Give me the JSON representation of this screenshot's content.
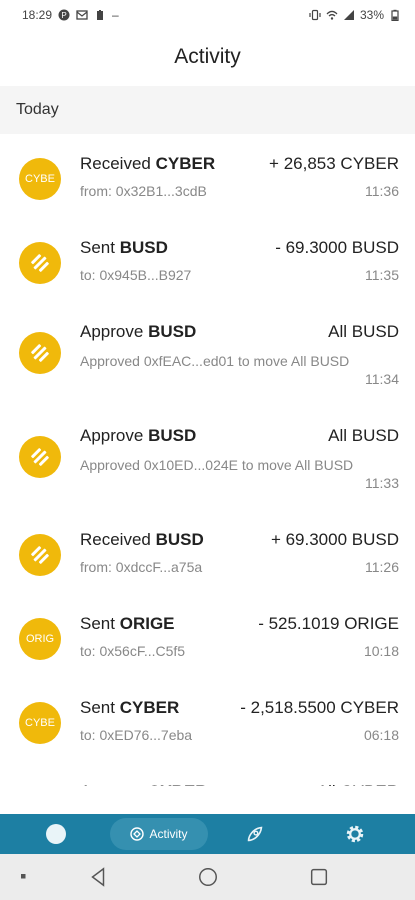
{
  "status_bar": {
    "time": "18:29",
    "battery": "33%",
    "dash": "–"
  },
  "header": {
    "title": "Activity"
  },
  "section": {
    "label": "Today"
  },
  "activities": [
    {
      "icon_text": "CYBE",
      "icon": "cyber-token-icon",
      "action": "Received",
      "token": "CYBER",
      "amount": "+ 26,853 CYBER",
      "sub": "from: 0x32B1...3cdB",
      "time": "11:36"
    },
    {
      "icon_text": "",
      "icon": "busd-token-icon",
      "action": "Sent",
      "token": "BUSD",
      "amount": "- 69.3000 BUSD",
      "sub": "to: 0x945B...B927",
      "time": "11:35"
    },
    {
      "icon_text": "",
      "icon": "busd-token-icon",
      "action": "Approve",
      "token": "BUSD",
      "amount": "All BUSD",
      "sub": "Approved 0xfEAC...ed01 to move All BUSD",
      "time": "11:34"
    },
    {
      "icon_text": "",
      "icon": "busd-token-icon",
      "action": "Approve",
      "token": "BUSD",
      "amount": "All BUSD",
      "sub": "Approved 0x10ED...024E to move All BUSD",
      "time": "11:33"
    },
    {
      "icon_text": "",
      "icon": "busd-token-icon",
      "action": "Received",
      "token": "BUSD",
      "amount": "+ 69.3000 BUSD",
      "sub": "from: 0xdccF...a75a",
      "time": "11:26"
    },
    {
      "icon_text": "ORIG",
      "icon": "orige-token-icon",
      "action": "Sent",
      "token": "ORIGE",
      "amount": "- 525.1019 ORIGE",
      "sub": "to: 0x56cF...C5f5",
      "time": "10:18"
    },
    {
      "icon_text": "CYBE",
      "icon": "cyber-token-icon",
      "action": "Sent",
      "token": "CYBER",
      "amount": "- 2,518.5500 CYBER",
      "sub": "to: 0xED76...7eba",
      "time": "06:18"
    },
    {
      "icon_text": "",
      "icon": "cyber-token-icon",
      "action": "Approve",
      "token": "CYBER",
      "amount": "All CYBER",
      "sub": "",
      "time": ""
    }
  ],
  "tab_bar": {
    "activity_label": "Activity"
  },
  "colors": {
    "token": "#f0b90b",
    "tab_bar": "#1d7fa3",
    "section_bg": "#f5f5f5"
  }
}
